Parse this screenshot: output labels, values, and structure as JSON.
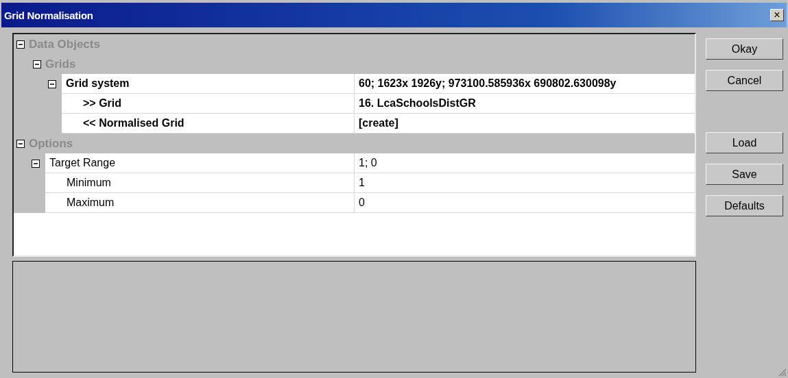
{
  "window": {
    "title": "Grid Normalisation",
    "close": "×"
  },
  "properties": [
    {
      "kind": "category",
      "label": "Data Objects",
      "expanded": true,
      "children": [
        {
          "kind": "category",
          "label": "Grids",
          "expanded": true,
          "children": [
            {
              "kind": "property",
              "label": "Grid system",
              "value": "60; 1623x 1926y; 973100.585936x 690802.630098y",
              "emphasized": true,
              "expanded": true,
              "children": [
                {
                  "kind": "property",
                  "label": ">> Grid",
                  "value": "16. LcaSchoolsDistGR",
                  "emphasized": true
                },
                {
                  "kind": "property",
                  "label": "<< Normalised Grid",
                  "value": "[create]",
                  "emphasized": true
                }
              ]
            }
          ]
        }
      ]
    },
    {
      "kind": "category",
      "label": "Options",
      "expanded": true,
      "children": [
        {
          "kind": "property",
          "label": "Target Range",
          "value": "1; 0",
          "emphasized": false,
          "expanded": true,
          "children": [
            {
              "kind": "property",
              "label": "Minimum",
              "value": "1",
              "emphasized": false
            },
            {
              "kind": "property",
              "label": "Maximum",
              "value": "0",
              "emphasized": false
            }
          ]
        }
      ]
    }
  ],
  "button_groups": [
    [
      "Okay",
      "Cancel"
    ],
    [
      "Load",
      "Save",
      "Defaults"
    ]
  ]
}
